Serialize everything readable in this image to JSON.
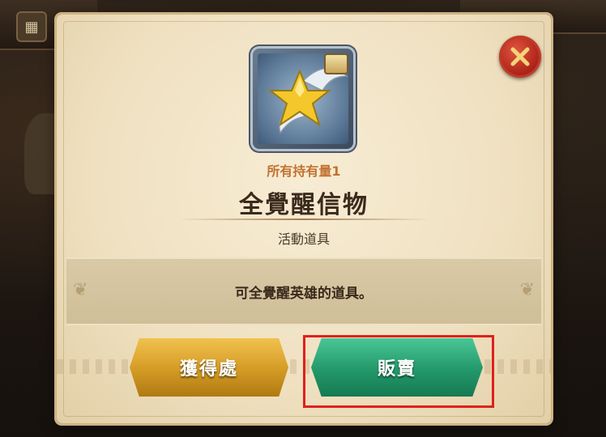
{
  "dialog": {
    "owned_label": "所有持有量1",
    "item_name": "全覺醒信物",
    "item_type": "活動道具",
    "description": "可全覺醒英雄的道具。"
  },
  "buttons": {
    "obtain_label": "獲得處",
    "sell_label": "販賣"
  },
  "icons": {
    "close": "close-icon",
    "item": "winged-star-icon",
    "menu": "grid-menu-icon"
  },
  "colors": {
    "owned_text": "#c27232",
    "obtain_button": "#d39a24",
    "sell_button": "#23986a",
    "close_button": "#a81f16",
    "highlight": "#e0201c"
  }
}
